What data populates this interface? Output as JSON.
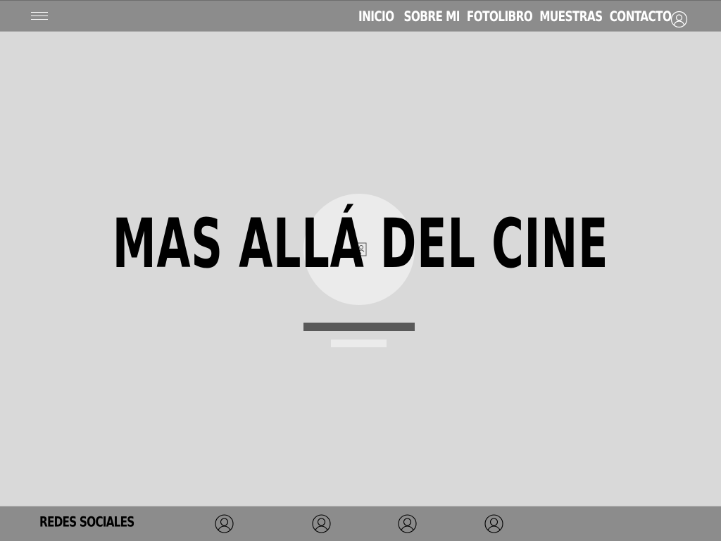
{
  "header": {
    "menu_icon": "hamburger-menu-icon",
    "nav": [
      {
        "label": "INICIO"
      },
      {
        "label": "SOBRE MI"
      },
      {
        "label": "FOTOLIBRO"
      },
      {
        "label": "MUESTRAS"
      },
      {
        "label": "CONTACTO"
      }
    ],
    "account_icon": "user-icon"
  },
  "hero": {
    "title": "MAS ALLÁ DEL CINE",
    "placeholder_icon": "image-placeholder-icon"
  },
  "footer": {
    "label": "REDES SOCIALES",
    "social_icons": [
      "user-icon",
      "user-icon",
      "user-icon",
      "user-icon"
    ]
  },
  "colors": {
    "background": "#d9d9d9",
    "bar": "#8c8c8c",
    "title": "#000000",
    "nav_text": "#ffffff",
    "placeholder_dark": "#595959",
    "placeholder_light": "#ebebeb"
  }
}
